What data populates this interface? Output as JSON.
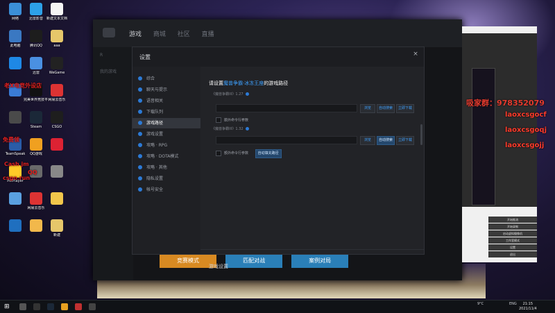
{
  "desktop": {
    "icons": [
      {
        "label": "网络",
        "color": "#3b8fd8"
      },
      {
        "label": "迅雷影音",
        "color": "#2da1e8"
      },
      {
        "label": "新建文本文档",
        "color": "#f4f4f4"
      },
      {
        "label": "此电脑",
        "color": "#3a78c2"
      },
      {
        "label": "腾讯QQ",
        "color": "#1d1d1d"
      },
      {
        "label": "aaa",
        "color": "#e6c76a"
      },
      {
        "label": "",
        "color": "#1e88e5"
      },
      {
        "label": "迅雷",
        "color": "#4a90e2"
      },
      {
        "label": "WeGame",
        "color": "#222"
      },
      {
        "label": "",
        "color": "#3a7bd5"
      },
      {
        "label": "完美世界竞技平台",
        "color": "#111"
      },
      {
        "label": "网易云音乐",
        "color": "#d33"
      },
      {
        "label": "",
        "color": "#4a4a4a"
      },
      {
        "label": "Steam",
        "color": "#1b2838"
      },
      {
        "label": "CSGO",
        "color": "#1e1e1e"
      },
      {
        "label": "TeamSpeak",
        "color": "#2a5ca8"
      },
      {
        "label": "QQ游戏",
        "color": "#f0a020"
      },
      {
        "label": "",
        "color": "#d23"
      },
      {
        "label": "PotPlayer",
        "color": "#ffca28"
      },
      {
        "label": "",
        "color": "#6a6a6a"
      },
      {
        "label": "",
        "color": "#888"
      },
      {
        "label": "",
        "color": "#5aa0e0"
      },
      {
        "label": "网易云音乐",
        "color": "#d33"
      },
      {
        "label": "",
        "color": "#f2c64b"
      },
      {
        "label": "",
        "color": "#1f6fbf"
      },
      {
        "label": "",
        "color": "#f2b84b"
      },
      {
        "label": "新建",
        "color": "#e6c76a"
      }
    ],
    "overlay_red": [
      "老X电竞外设店",
      "免费领",
      "Cash jm",
      "csgo.run",
      "QQ"
    ]
  },
  "client": {
    "nav": [
      {
        "label": "游戏",
        "active": true
      },
      {
        "label": "商城",
        "active": false
      },
      {
        "label": "社区",
        "active": false
      },
      {
        "label": "直播",
        "active": false
      }
    ],
    "sidebar": [
      "R",
      "我的游戏",
      "",
      "",
      "",
      "",
      "",
      "",
      "",
      "",
      "",
      ""
    ],
    "bottom_buttons": [
      {
        "label": "竞赛模式",
        "color": "#d88a22"
      },
      {
        "label": "匹配对战",
        "color": "#2a7fb8"
      },
      {
        "label": "案例对局",
        "color": "#2a7fb8"
      }
    ]
  },
  "dialog": {
    "title": "设置",
    "close": "×",
    "nav": [
      {
        "label": "综合",
        "active": false
      },
      {
        "label": "聊天与提示",
        "active": false
      },
      {
        "label": "语音相关",
        "active": false
      },
      {
        "label": "下载队列",
        "active": false
      },
      {
        "label": "游戏路径",
        "active": true
      },
      {
        "label": "游戏设置",
        "active": false
      },
      {
        "label": "攻略 · RPG",
        "active": false
      },
      {
        "label": "攻略 · DOTA模式",
        "active": false
      },
      {
        "label": "攻略 · 其他",
        "active": false
      },
      {
        "label": "隐私设置",
        "active": false
      },
      {
        "label": "帐号安全",
        "active": false
      }
    ],
    "section": {
      "title_prefix": "请设置",
      "title_highlight": "魔兽争霸·冰冻王座",
      "title_suffix": "的游戏路径"
    },
    "versions": [
      {
        "label": "《魔兽争霸III》1.27",
        "path_value": "",
        "path_placeholder": "",
        "btn_browse": "浏览",
        "btn_auto": "自动搜索",
        "btn_download": "立即下载",
        "checkbox_label": "额外命令行参数",
        "extra_button": ""
      },
      {
        "label": "《魔兽争霸III》1.32",
        "path_value": "",
        "path_placeholder": "",
        "btn_browse": "浏览",
        "btn_auto": "自动搜索",
        "btn_download": "立即下载",
        "checkbox_label": "额外命令行参数",
        "extra_button": "自动填充路径"
      }
    ],
    "game_settings_heading": "游戏设置"
  },
  "obs": {
    "menu": [
      "开始推流",
      "开始录制",
      "启动虚拟摄像机",
      "工作室模式",
      "设置",
      "退出"
    ],
    "overlay_lines": [
      {
        "text": "吸家群：978352079",
        "color": "#e63b2e"
      },
      {
        "text": "laoxcsgocf",
        "color": "#ff3a2a"
      },
      {
        "text": "laoxcsgoqj",
        "color": "#ff3a2a"
      },
      {
        "text": "laoxcsgojj",
        "color": "#ff3a2a"
      }
    ]
  },
  "taskbar": {
    "weather": "9°C",
    "lang": "ENG",
    "time": "21:15",
    "date": "2021/11/4"
  }
}
